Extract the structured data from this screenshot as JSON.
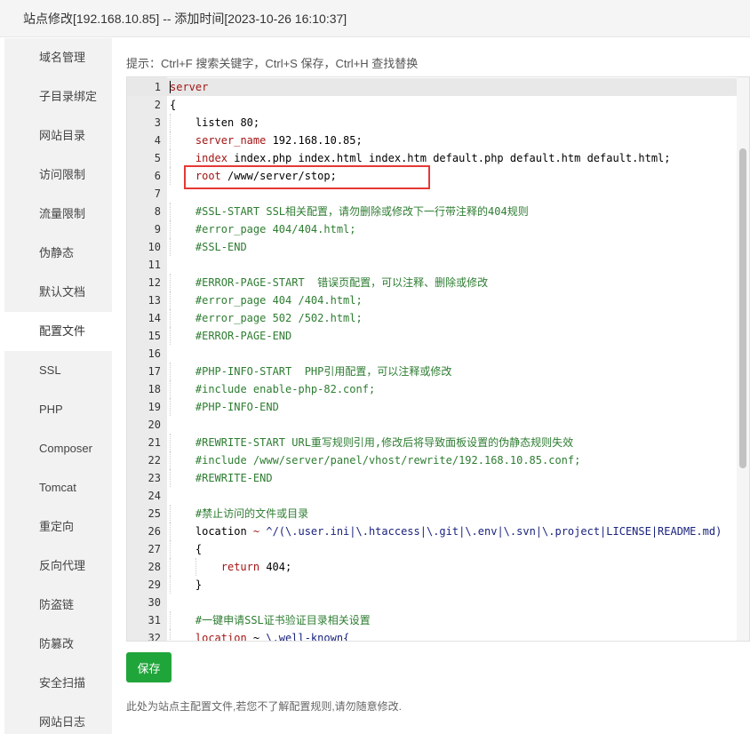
{
  "window": {
    "title": "站点修改[192.168.10.85] -- 添加时间[2023-10-26 16:10:37]"
  },
  "sidebar": {
    "items": [
      {
        "label": "域名管理",
        "active": false
      },
      {
        "label": "子目录绑定",
        "active": false
      },
      {
        "label": "网站目录",
        "active": false
      },
      {
        "label": "访问限制",
        "active": false
      },
      {
        "label": "流量限制",
        "active": false
      },
      {
        "label": "伪静态",
        "active": false
      },
      {
        "label": "默认文档",
        "active": false
      },
      {
        "label": "配置文件",
        "active": true
      },
      {
        "label": "SSL",
        "active": false
      },
      {
        "label": "PHP",
        "active": false
      },
      {
        "label": "Composer",
        "active": false
      },
      {
        "label": "Tomcat",
        "active": false
      },
      {
        "label": "重定向",
        "active": false
      },
      {
        "label": "反向代理",
        "active": false
      },
      {
        "label": "防盗链",
        "active": false
      },
      {
        "label": "防篡改",
        "active": false
      },
      {
        "label": "安全扫描",
        "active": false
      },
      {
        "label": "网站日志",
        "active": false
      }
    ]
  },
  "editor": {
    "hint": "提示：Ctrl+F 搜索关键字，Ctrl+S 保存，Ctrl+H 查找替换",
    "lines": [
      {
        "n": "1",
        "indent": 0,
        "parts": [
          {
            "t": "server",
            "c": "kw"
          }
        ]
      },
      {
        "n": "2",
        "indent": 0,
        "parts": [
          {
            "t": "{",
            "c": "pl"
          }
        ]
      },
      {
        "n": "3",
        "indent": 1,
        "parts": [
          {
            "t": "listen 80;",
            "c": "pl"
          }
        ]
      },
      {
        "n": "4",
        "indent": 1,
        "parts": [
          {
            "t": "server_name",
            "c": "kw"
          },
          {
            "t": " 192.168.10.85;",
            "c": "pl"
          }
        ]
      },
      {
        "n": "5",
        "indent": 1,
        "parts": [
          {
            "t": "index",
            "c": "kw"
          },
          {
            "t": " index.php index.html index.htm default.php default.htm default.html;",
            "c": "pl"
          }
        ]
      },
      {
        "n": "6",
        "indent": 1,
        "parts": [
          {
            "t": "root",
            "c": "kw"
          },
          {
            "t": " /www/server/stop;",
            "c": "pl"
          }
        ]
      },
      {
        "n": "7",
        "indent": 0,
        "parts": []
      },
      {
        "n": "8",
        "indent": 1,
        "parts": [
          {
            "t": "#SSL-START SSL相关配置，请勿删除或修改下一行带注释的404规则",
            "c": "cm"
          }
        ]
      },
      {
        "n": "9",
        "indent": 1,
        "parts": [
          {
            "t": "#error_page 404/404.html;",
            "c": "cm"
          }
        ]
      },
      {
        "n": "10",
        "indent": 1,
        "parts": [
          {
            "t": "#SSL-END",
            "c": "cm"
          }
        ]
      },
      {
        "n": "11",
        "indent": 0,
        "parts": []
      },
      {
        "n": "12",
        "indent": 1,
        "parts": [
          {
            "t": "#ERROR-PAGE-START  错误页配置，可以注释、删除或修改",
            "c": "cm"
          }
        ]
      },
      {
        "n": "13",
        "indent": 1,
        "parts": [
          {
            "t": "#error_page 404 /404.html;",
            "c": "cm"
          }
        ]
      },
      {
        "n": "14",
        "indent": 1,
        "parts": [
          {
            "t": "#error_page 502 /502.html;",
            "c": "cm"
          }
        ]
      },
      {
        "n": "15",
        "indent": 1,
        "parts": [
          {
            "t": "#ERROR-PAGE-END",
            "c": "cm"
          }
        ]
      },
      {
        "n": "16",
        "indent": 0,
        "parts": []
      },
      {
        "n": "17",
        "indent": 1,
        "parts": [
          {
            "t": "#PHP-INFO-START  PHP引用配置，可以注释或修改",
            "c": "cm"
          }
        ]
      },
      {
        "n": "18",
        "indent": 1,
        "parts": [
          {
            "t": "#include enable-php-82.conf;",
            "c": "cm"
          }
        ]
      },
      {
        "n": "19",
        "indent": 1,
        "parts": [
          {
            "t": "#PHP-INFO-END",
            "c": "cm"
          }
        ]
      },
      {
        "n": "20",
        "indent": 0,
        "parts": []
      },
      {
        "n": "21",
        "indent": 1,
        "parts": [
          {
            "t": "#REWRITE-START URL重写规则引用,修改后将导致面板设置的伪静态规则失效",
            "c": "cm"
          }
        ]
      },
      {
        "n": "22",
        "indent": 1,
        "parts": [
          {
            "t": "#include /www/server/panel/vhost/rewrite/192.168.10.85.conf;",
            "c": "cm"
          }
        ]
      },
      {
        "n": "23",
        "indent": 1,
        "parts": [
          {
            "t": "#REWRITE-END",
            "c": "cm"
          }
        ]
      },
      {
        "n": "24",
        "indent": 0,
        "parts": []
      },
      {
        "n": "25",
        "indent": 1,
        "parts": [
          {
            "t": "#禁止访问的文件或目录",
            "c": "cm"
          }
        ]
      },
      {
        "n": "26",
        "indent": 1,
        "parts": [
          {
            "t": "location",
            "c": "pl"
          },
          {
            "t": " ~ ",
            "c": "kw"
          },
          {
            "t": "^/(\\.user.ini|\\.htaccess|\\.git|\\.env|\\.svn|\\.project|LICENSE|README.md)",
            "c": "rx"
          }
        ]
      },
      {
        "n": "27",
        "indent": 1,
        "parts": [
          {
            "t": "{",
            "c": "pl"
          }
        ]
      },
      {
        "n": "28",
        "indent": 2,
        "parts": [
          {
            "t": "return",
            "c": "kw"
          },
          {
            "t": " 404;",
            "c": "pl"
          }
        ]
      },
      {
        "n": "29",
        "indent": 1,
        "parts": [
          {
            "t": "}",
            "c": "pl"
          }
        ]
      },
      {
        "n": "30",
        "indent": 0,
        "parts": []
      },
      {
        "n": "31",
        "indent": 1,
        "parts": [
          {
            "t": "#一键申请SSL证书验证目录相关设置",
            "c": "cm"
          }
        ]
      },
      {
        "n": "32",
        "indent": 1,
        "parts": [
          {
            "t": "location",
            "c": "kw"
          },
          {
            "t": " ~ ",
            "c": "pl"
          },
          {
            "t": "\\.well-known{",
            "c": "rx"
          }
        ]
      }
    ]
  },
  "actions": {
    "save_label": "保存"
  },
  "footer": {
    "note": "此处为站点主配置文件,若您不了解配置规则,请勿随意修改."
  }
}
